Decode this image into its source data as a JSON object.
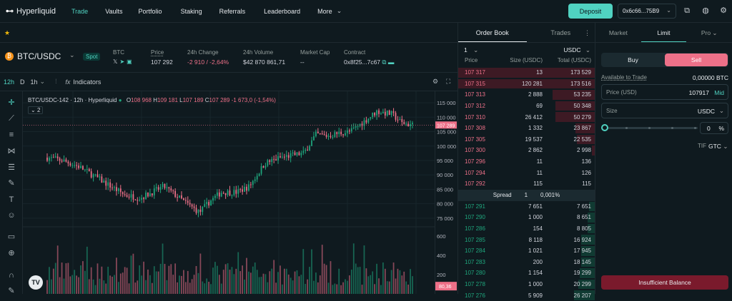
{
  "header": {
    "logo": "Hyperliquid",
    "nav": [
      {
        "label": "Trade",
        "active": true
      },
      {
        "label": "Vaults"
      },
      {
        "label": "Portfolio"
      },
      {
        "label": "Staking"
      },
      {
        "label": "Referrals"
      },
      {
        "label": "Leaderboard"
      },
      {
        "label": "More"
      }
    ],
    "deposit": "Deposit",
    "wallet": "0x6c66...75B9"
  },
  "market": {
    "pair": "BTC/USDC",
    "badge": "Spot",
    "token": "BTC",
    "price_label": "Price",
    "price": "107 292",
    "change_label": "24h Change",
    "change": "-2 910 / -2,64%",
    "volume_label": "24h Volume",
    "volume": "$42 870 861,71",
    "cap_label": "Market Cap",
    "cap": "--",
    "contract_label": "Contract",
    "contract": "0x8f25...7c67"
  },
  "toolbar": {
    "intervals": [
      "12h",
      "D",
      "1h"
    ],
    "indicators": "Indicators"
  },
  "chart_legend": {
    "title": "BTC/USDC-142 · 12h · Hyperliquid",
    "o": "O",
    "o_val": "108 968",
    "h": "H",
    "h_val": "109 181",
    "l": "L",
    "l_val": "107 189",
    "c": "C",
    "c_val": "107 289",
    "chg": "-1 673,0 (-1,54%)",
    "count": "2"
  },
  "chart_data": {
    "type": "candlestick",
    "price_ticks": [
      "115 000",
      "110 000",
      "105 000",
      "100 000",
      "95 000",
      "90 000",
      "85 000",
      "80 000",
      "75 000"
    ],
    "volume_ticks": [
      "600",
      "400",
      "200"
    ],
    "last_price": "107 289",
    "last_volume": "80,36",
    "ylim": [
      72000,
      117000
    ],
    "colors": {
      "up": "#1fa67d",
      "down": "#ed7088"
    }
  },
  "orderbook": {
    "tab_book": "Order Book",
    "tab_trades": "Trades",
    "agg": "1",
    "unit": "USDC",
    "col_price": "Price",
    "col_size": "Size (USDC)",
    "col_total": "Total (USDC)",
    "asks": [
      [
        "107 317",
        "13",
        "173 529"
      ],
      [
        "107 315",
        "120 281",
        "173 516"
      ],
      [
        "107 313",
        "2 888",
        "53 235"
      ],
      [
        "107 312",
        "69",
        "50 348"
      ],
      [
        "107 310",
        "26 412",
        "50 279"
      ],
      [
        "107 308",
        "1 332",
        "23 867"
      ],
      [
        "107 305",
        "19 537",
        "22 535"
      ],
      [
        "107 300",
        "2 862",
        "2 998"
      ],
      [
        "107 296",
        "11",
        "136"
      ],
      [
        "107 294",
        "11",
        "126"
      ],
      [
        "107 292",
        "115",
        "115"
      ]
    ],
    "ask_depth": [
      1,
      1,
      0.31,
      0.29,
      0.29,
      0.14,
      0.13,
      0.02,
      0.0,
      0.0,
      0.0
    ],
    "spread_label": "Spread",
    "spread_val": "1",
    "spread_pct": "0,001%",
    "bids": [
      [
        "107 291",
        "7 651",
        "7 651"
      ],
      [
        "107 290",
        "1 000",
        "8 651"
      ],
      [
        "107 286",
        "154",
        "8 805"
      ],
      [
        "107 285",
        "8 118",
        "16 924"
      ],
      [
        "107 284",
        "1 021",
        "17 945"
      ],
      [
        "107 283",
        "200",
        "18 145"
      ],
      [
        "107 280",
        "1 154",
        "19 299"
      ],
      [
        "107 278",
        "1 000",
        "20 299"
      ],
      [
        "107 276",
        "5 909",
        "26 207"
      ]
    ],
    "bid_depth": [
      0.04,
      0.05,
      0.05,
      0.1,
      0.1,
      0.1,
      0.11,
      0.12,
      0.15
    ]
  },
  "trade": {
    "tab_market": "Market",
    "tab_limit": "Limit",
    "tab_pro": "Pro",
    "buy": "Buy",
    "sell": "Sell",
    "avail_label": "Available to Trade",
    "avail_val": "0,00000 BTC",
    "price_label": "Price (USD)",
    "price_val": "107917",
    "mid": "Mid",
    "size_label": "Size",
    "size_unit": "USDC",
    "pct_val": "0",
    "pct_sign": "%",
    "tif_label": "TIF",
    "tif_val": "GTC",
    "submit": "Insufficient Balance"
  }
}
